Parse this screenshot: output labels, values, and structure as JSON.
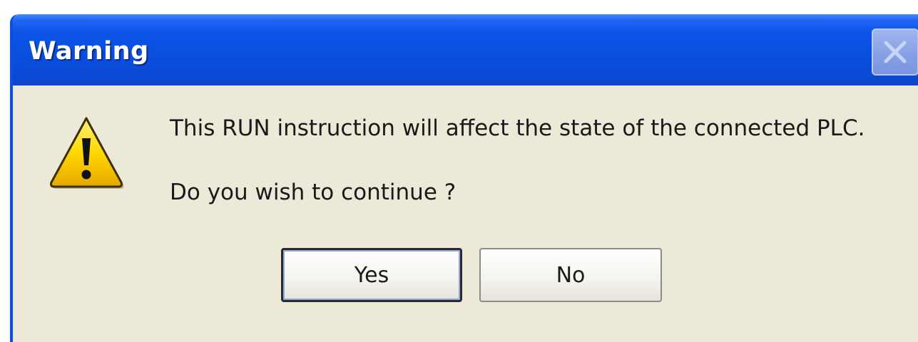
{
  "dialog": {
    "title": "Warning",
    "message_line1": "This RUN instruction will affect the state of the connected PLC.",
    "message_line2": "Do you wish to continue ?",
    "icon": "warning-icon",
    "buttons": {
      "yes_label": "Yes",
      "no_label": "No"
    },
    "close_icon": "close-icon"
  },
  "colors": {
    "titlebar": "#0a4fe0",
    "body": "#ece9d8",
    "warning_yellow": "#ffd400"
  }
}
